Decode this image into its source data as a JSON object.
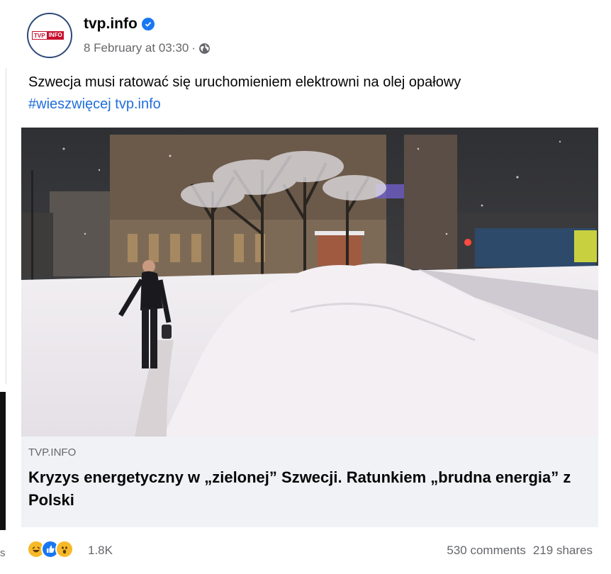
{
  "page": {
    "name": "tvp.info",
    "date": "8 February at 03:30",
    "separator": "·"
  },
  "avatar": {
    "tvp": "TVP",
    "info": "INFO"
  },
  "post": {
    "text": "Szwecja musi ratować się uruchomieniem elektrowni na olej opałowy",
    "hashtag": "#wieszwięcej tvp.info"
  },
  "preview": {
    "domain": "TVP.INFO",
    "headline": "Kryzys energetyczny w „zielonej” Szwecji. Ratunkiem „brudna energia” z Polski"
  },
  "footer": {
    "reaction_count": "1.8K",
    "comments": "530 comments",
    "shares": "219 shares"
  },
  "left_edge": {
    "fragment": "s"
  },
  "colors": {
    "accent": "#1877f2",
    "hashtag": "#216fdb",
    "preview_bg": "#f0f2f5",
    "brand_red": "#c8102e"
  }
}
